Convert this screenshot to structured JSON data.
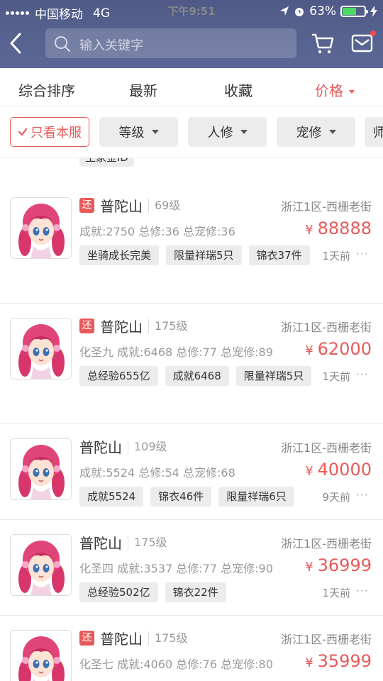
{
  "status_bar": {
    "carrier": "中国移动",
    "network": "4G",
    "time": "下午9:51",
    "battery": "63%",
    "battery_level": 0.63
  },
  "search": {
    "placeholder": "输入关键字"
  },
  "sort_tabs": [
    "综合排序",
    "最新",
    "收藏",
    "价格"
  ],
  "filters": {
    "only_this_server": "只看本服",
    "chips": [
      "等级",
      "人修",
      "宠修",
      "师"
    ]
  },
  "partial_tag": "王家金ID",
  "currency": "¥",
  "more_icon_text": "···",
  "items": [
    {
      "badge": "还",
      "name": "普陀山",
      "level": "69级",
      "server": "浙江1区-西栅老街",
      "stats": "成就:2750 总修:36 总宠修:36",
      "price": "88888",
      "tags": [
        "坐骑成长完美",
        "限量祥瑞5只",
        "锦衣37件"
      ],
      "time": "1天前"
    },
    {
      "badge": "还",
      "name": "普陀山",
      "level": "175级",
      "server": "浙江1区-西栅老街",
      "stats": "化圣九 成就:6468 总修:77 总宠修:89",
      "price": "62000",
      "tags": [
        "总经验655亿",
        "成就6468",
        "限量祥瑞5只"
      ],
      "time": "1天前"
    },
    {
      "badge": "",
      "name": "普陀山",
      "level": "109级",
      "server": "浙江1区-西栅老街",
      "stats": "成就:5524 总修:54 总宠修:68",
      "price": "40000",
      "tags": [
        "成就5524",
        "锦衣46件",
        "限量祥瑞6只"
      ],
      "time": "9天前"
    },
    {
      "badge": "",
      "name": "普陀山",
      "level": "175级",
      "server": "浙江1区-西栅老街",
      "stats": "化圣四 成就:3537 总修:77 总宠修:90",
      "price": "36999",
      "tags": [
        "总经验502亿",
        "锦衣22件"
      ],
      "time": "1天前"
    },
    {
      "badge": "还",
      "name": "普陀山",
      "level": "175级",
      "server": "浙江1区-西栅老街",
      "stats": "化圣七 成就:4060 总修:76 总宠修:80",
      "price": "35999",
      "tags": [],
      "time": ""
    }
  ]
}
